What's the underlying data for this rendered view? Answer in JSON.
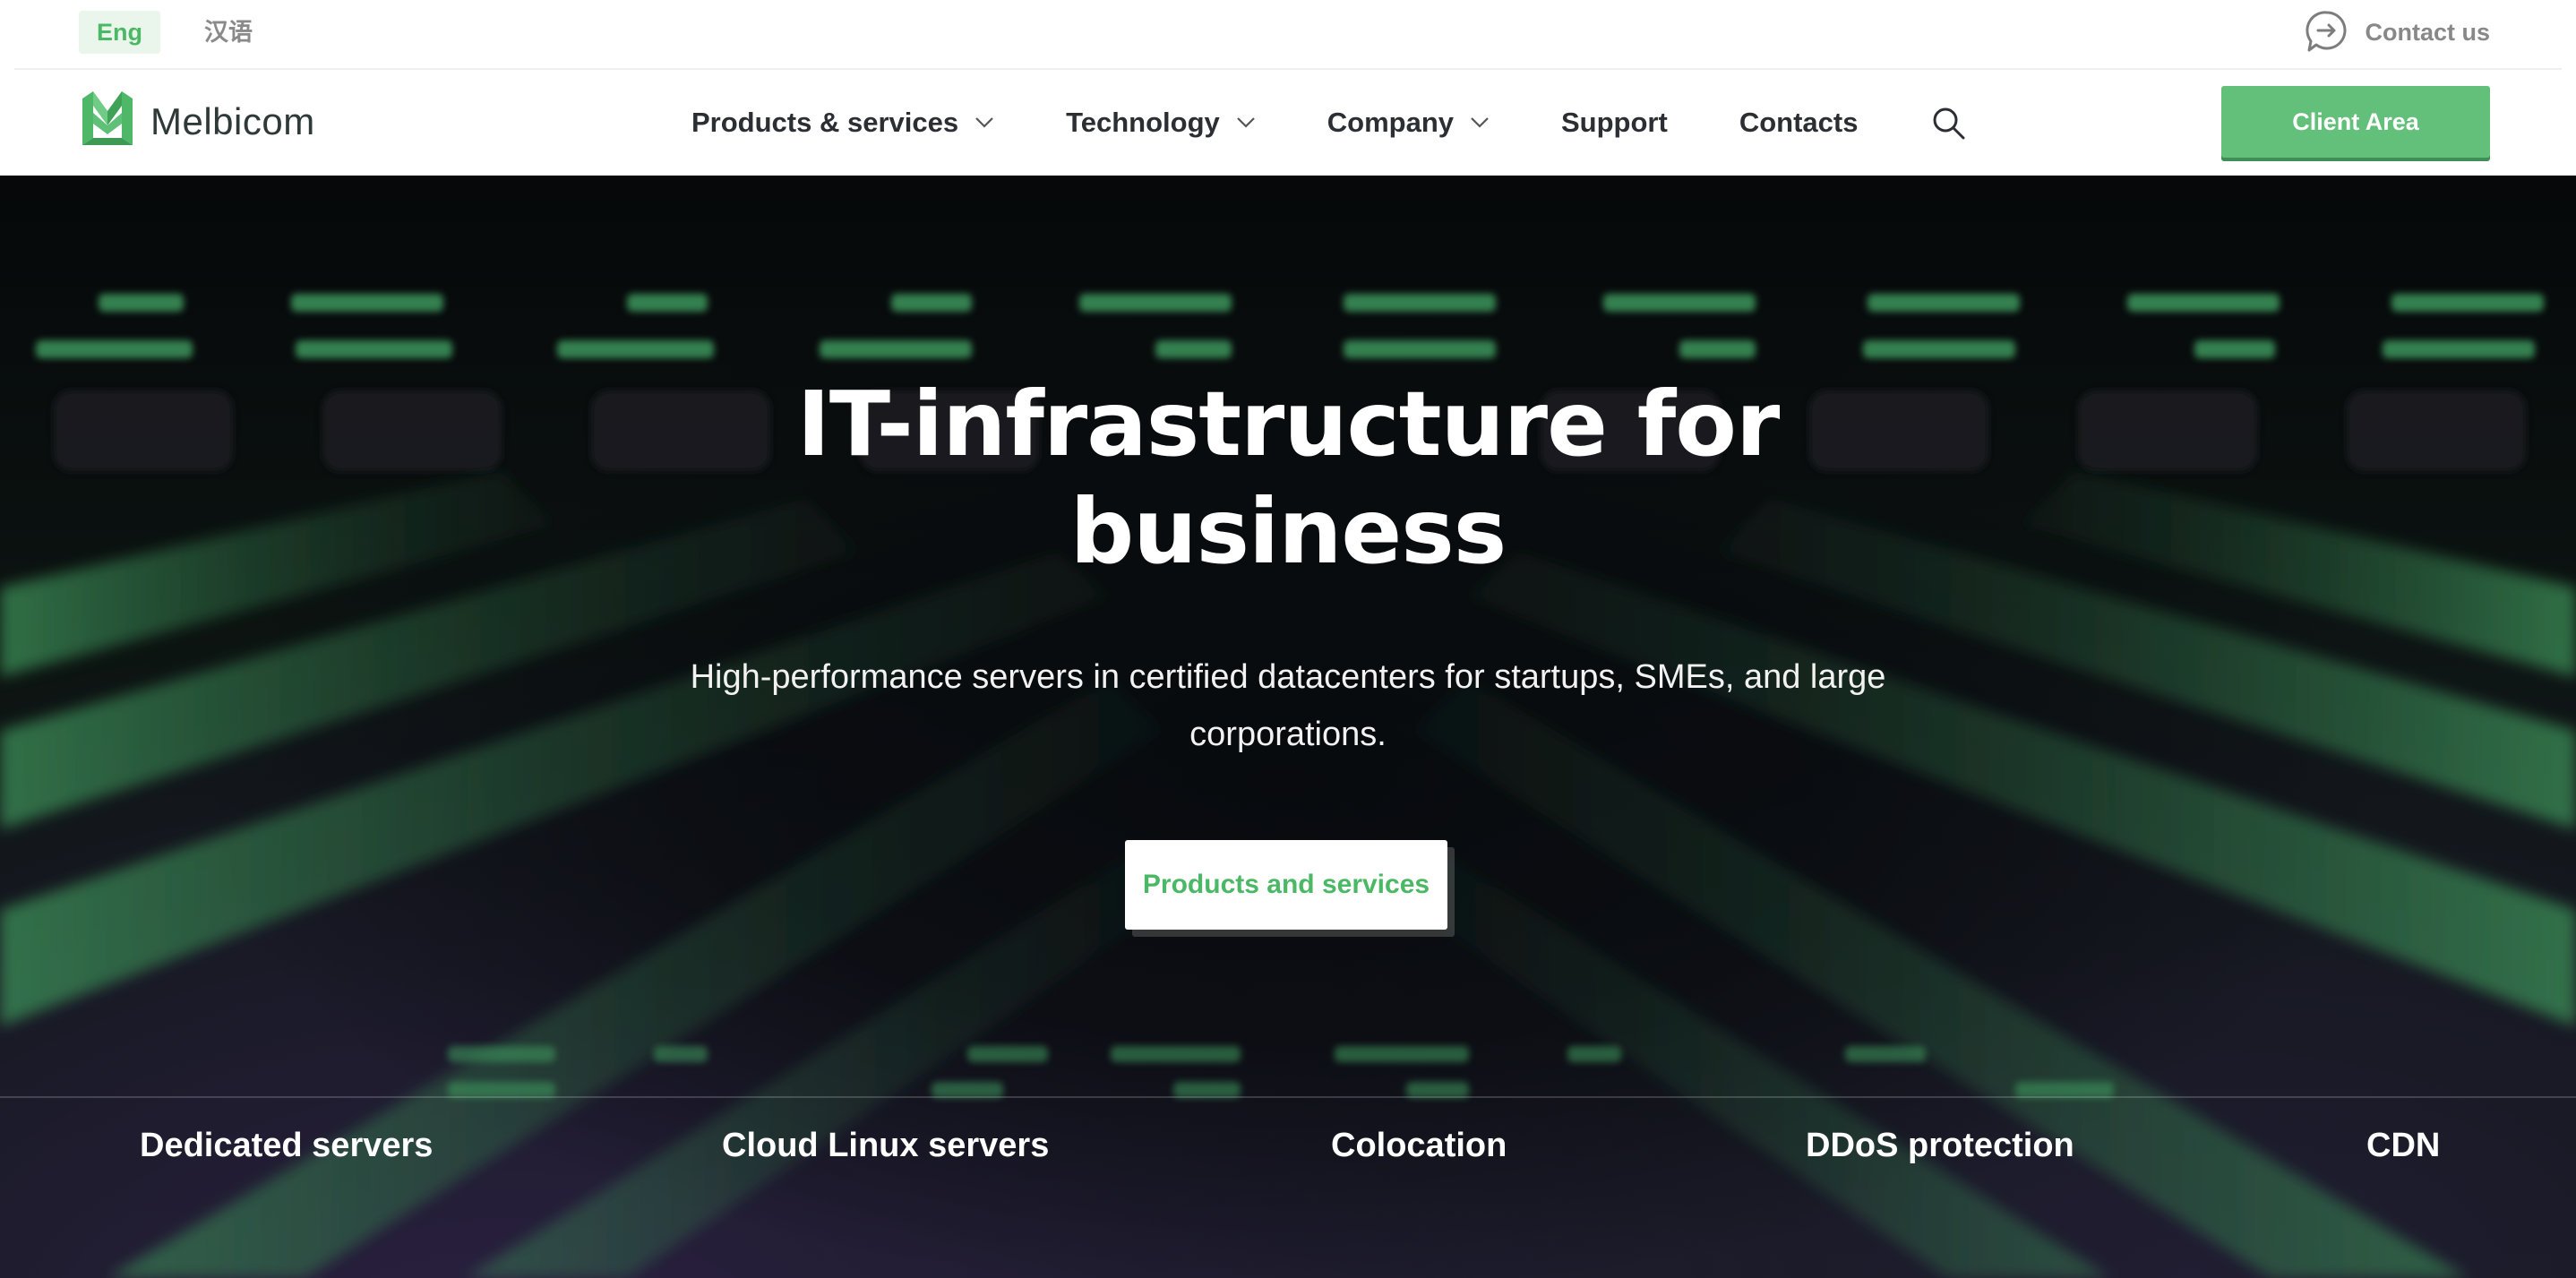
{
  "topbar": {
    "languages": [
      "Eng",
      "汉语"
    ],
    "active_language": "Eng",
    "contact_label": "Contact us",
    "contact_icon": "chat-arrow-icon"
  },
  "navbar": {
    "logo_text": "Melbicom",
    "menu": [
      {
        "label": "Products & services",
        "has_dropdown": true
      },
      {
        "label": "Technology",
        "has_dropdown": true
      },
      {
        "label": "Company",
        "has_dropdown": true
      },
      {
        "label": "Support",
        "has_dropdown": false
      },
      {
        "label": "Contacts",
        "has_dropdown": false
      }
    ],
    "search_icon": "search-icon",
    "client_area_label": "Client Area"
  },
  "hero": {
    "title_line1": "IT-infrastructure for",
    "title_line2": "business",
    "subtitle_line1": "High-performance servers in certified datacenters for startups, SMEs, and large",
    "subtitle_line2": "corporations.",
    "cta_label": "Products and services"
  },
  "services": [
    "Dedicated servers",
    "Cloud Linux servers",
    "Colocation",
    "DDoS protection",
    "CDN"
  ],
  "colors": {
    "brand_green": "#63c07a",
    "text_green": "#4ab865",
    "hero_dark": "#0c1411"
  }
}
